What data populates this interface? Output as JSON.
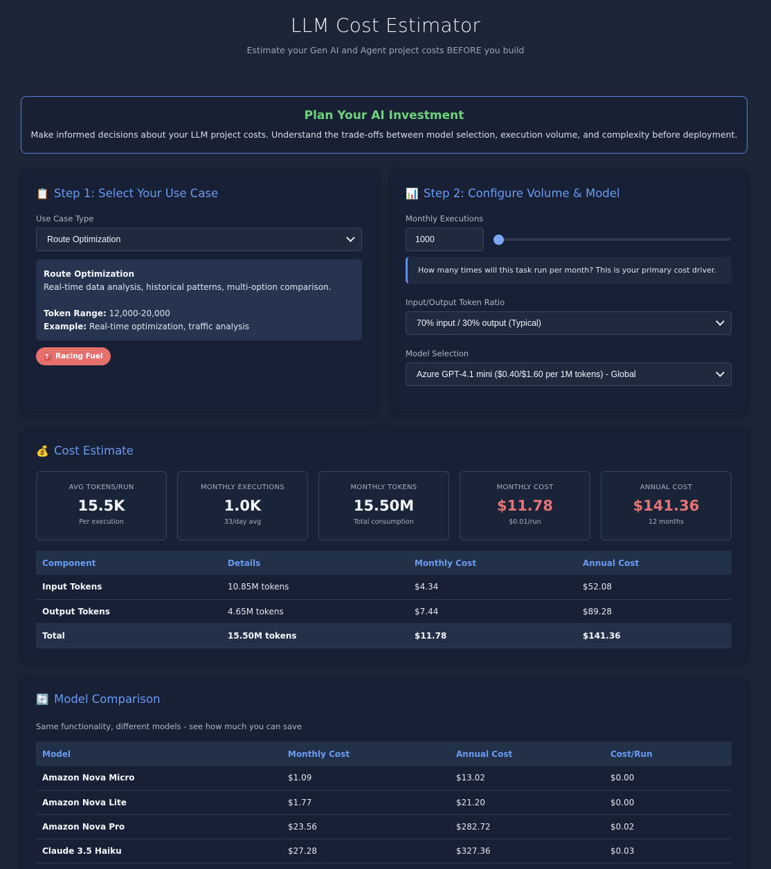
{
  "header": {
    "title": "LLM Cost Estimator",
    "subtitle": "Estimate your Gen AI and Agent project costs BEFORE you build"
  },
  "banner": {
    "title": "Plan Your AI Investment",
    "text": "Make informed decisions about your LLM project costs. Understand the trade-offs between model selection, execution volume, and complexity before deployment."
  },
  "step1": {
    "icon": "clipboard-icon",
    "icon_glyph": "📋",
    "title": "Step 1: Select Your Use Case",
    "use_case_label": "Use Case Type",
    "use_case_value": "Route Optimization",
    "info": {
      "name": "Route Optimization",
      "description": "Real-time data analysis, historical patterns, multi-option comparison.",
      "token_range_label": "Token Range:",
      "token_range_value": "12,000-20,000",
      "example_label": "Example:",
      "example_value": "Real-time optimization, traffic analysis"
    },
    "badge": {
      "icon": "fuel-pump-icon",
      "icon_glyph": "⛽",
      "label": "Racing Fuel"
    }
  },
  "step2": {
    "icon": "chart-icon",
    "icon_glyph": "📊",
    "title": "Step 2: Configure Volume & Model",
    "executions_label": "Monthly Executions",
    "executions_value": "1000",
    "slider_fraction": 0.0,
    "hint": "How many times will this task run per month? This is your primary cost driver.",
    "ratio_label": "Input/Output Token Ratio",
    "ratio_value": "70% input / 30% output (Typical)",
    "model_label": "Model Selection",
    "model_value": "Azure GPT-4.1 mini ($0.40/$1.60 per 1M tokens) - Global"
  },
  "estimate": {
    "icon": "money-bag-icon",
    "icon_glyph": "💰",
    "title": "Cost Estimate",
    "stats": [
      {
        "label": "AVG TOKENS/RUN",
        "value": "15.5K",
        "sub": "Per execution"
      },
      {
        "label": "MONTHLY EXECUTIONS",
        "value": "1.0K",
        "sub": "33/day avg"
      },
      {
        "label": "MONTHLY TOKENS",
        "value": "15.50M",
        "sub": "Total consumption"
      },
      {
        "label": "MONTHLY COST",
        "value": "$11.78",
        "sub": "$0.01/run"
      },
      {
        "label": "ANNUAL COST",
        "value": "$141.36",
        "sub": "12 months"
      }
    ],
    "highlight_color": "#e67373",
    "table": {
      "headers": [
        "Component",
        "Details",
        "Monthly Cost",
        "Annual Cost"
      ],
      "rows": [
        [
          "Input Tokens",
          "10.85M tokens",
          "$4.34",
          "$52.08"
        ],
        [
          "Output Tokens",
          "4.65M tokens",
          "$7.44",
          "$89.28"
        ]
      ],
      "total": [
        "Total",
        "15.50M tokens",
        "$11.78",
        "$141.36"
      ]
    }
  },
  "comparison": {
    "icon": "cycle-arrows-icon",
    "icon_glyph": "🔄",
    "title": "Model Comparison",
    "subtitle": "Same functionality, different models - see how much you can save",
    "headers": [
      "Model",
      "Monthly Cost",
      "Annual Cost",
      "Cost/Run"
    ],
    "rows": [
      [
        "Amazon Nova Micro",
        "$1.09",
        "$13.02",
        "$0.00"
      ],
      [
        "Amazon Nova Lite",
        "$1.77",
        "$21.20",
        "$0.00"
      ],
      [
        "Amazon Nova Pro",
        "$23.56",
        "$282.72",
        "$0.02"
      ],
      [
        "Claude 3.5 Haiku",
        "$27.28",
        "$327.36",
        "$0.03"
      ]
    ]
  },
  "colors": {
    "accent": "#6a9bf3",
    "success": "#6fd37d",
    "danger": "#e67373",
    "background": "#1b2536"
  }
}
